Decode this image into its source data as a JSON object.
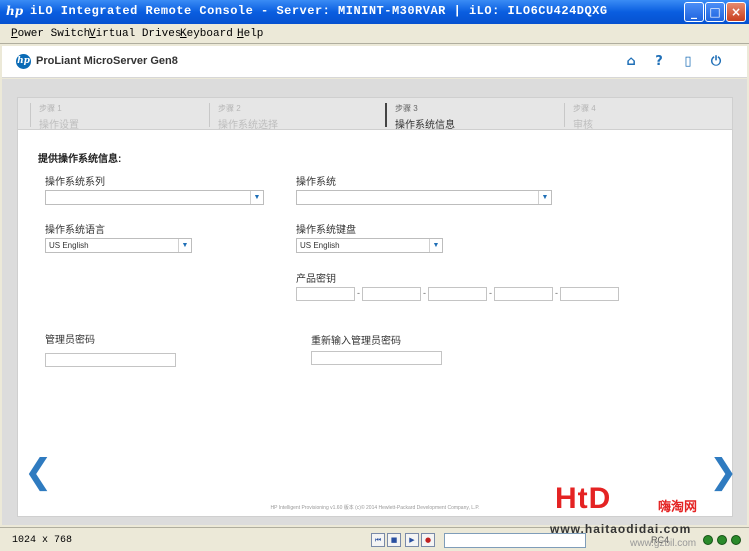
{
  "window": {
    "hp_glyph": "hp",
    "title": "iLO Integrated Remote Console - Server: MININT-M30RVAR | iLO: ILO6CU424DQXG",
    "minimize": "_",
    "maximize": "□",
    "close": "×"
  },
  "menu": [
    "Power Switch",
    "Virtual Drives",
    "Keyboard",
    "Help"
  ],
  "header": {
    "logo_text": "hp",
    "product": "ProLiant MicroServer Gen8",
    "icons": {
      "home": "⌂",
      "help": "?",
      "clipboard": "▯",
      "power": "⏻"
    }
  },
  "steps": [
    {
      "num": "步骤 1",
      "name": "操作设置"
    },
    {
      "num": "步骤 2",
      "name": "操作系统选择"
    },
    {
      "num": "步骤 3",
      "name": "操作系统信息"
    },
    {
      "num": "步骤 4",
      "name": "审核"
    }
  ],
  "form": {
    "section_title": "提供操作系统信息:",
    "os_family_label": "操作系统系列",
    "os_family_value": "",
    "os_label": "操作系统",
    "os_value": "",
    "os_lang_label": "操作系统语言",
    "os_lang_value": "US English",
    "keyboard_label": "操作系统键盘",
    "keyboard_value": "US English",
    "product_key_label": "产品密钥",
    "admin_pw_label": "管理员密码",
    "admin_pw_confirm_label": "重新输入管理员密码",
    "dropdown_arrow": "▼"
  },
  "nav": {
    "prev": "❮",
    "next": "❯"
  },
  "footer": "HP Intelligent Provisioning v1.60 版本 (c)© 2014 Hewlett-Packard Development Company, L.P.",
  "statusbar": {
    "resolution": "1024 x 768",
    "media_controls": [
      "⏮",
      "■",
      "▶",
      "●"
    ],
    "encryption": "RC4"
  },
  "watermark": {
    "logo": "HtD",
    "sub": "嗨淘网",
    "url": "www.haitaodidai.com",
    "url2": "www.gzbil.com"
  },
  "colors": {
    "titlebar": "#0a5ee0",
    "accent_blue": "#1f6fb7",
    "panel_bg": "#dcdcdc",
    "watermark_red": "#e42323"
  }
}
